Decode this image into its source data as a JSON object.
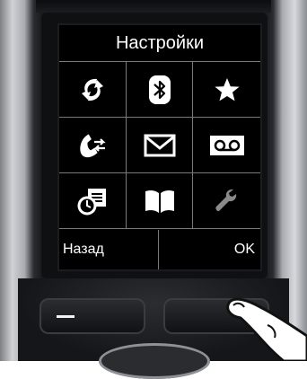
{
  "screen": {
    "title": "Настройки",
    "icons": [
      "sync-icon",
      "bluetooth-icon",
      "star-icon",
      "call-forward-icon",
      "message-envelope-icon",
      "voicemail-icon",
      "reminder-calendar-icon",
      "phonebook-icon",
      "settings-wrench-icon"
    ],
    "softkey_left": "Назад",
    "softkey_right": "OK"
  },
  "colors": {
    "screen_bg": "#000000",
    "icon": "#ffffff",
    "wrench_icon": "#8a8a8a",
    "grid_lines": "#7a7a7a"
  }
}
